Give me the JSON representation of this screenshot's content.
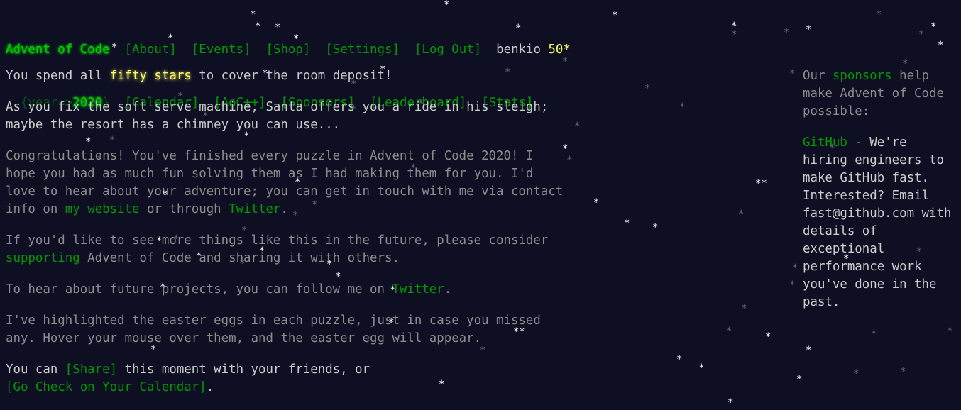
{
  "header": {
    "site_title": "Advent of Code",
    "nav_top": [
      "[About]",
      "[Events]",
      "[Shop]",
      "[Settings]",
      "[Log Out]"
    ],
    "username": "benkio",
    "star_count": "50*",
    "year_prefix": "{year=>",
    "year": "2020",
    "year_suffix": "}",
    "nav_bottom": [
      "[Calendar]",
      "[AoC++]",
      "[Sponsors]",
      "[Leaderboard]",
      "[Stats]"
    ]
  },
  "main": {
    "p1_before": "You spend all ",
    "p1_highlight": "fifty stars",
    "p1_after": " to cover the room deposit!",
    "p2_line1": "As you fix the soft serve machine, Santa offers you a ride in his sleigh;",
    "p2_line2": "maybe the resort has a chimney you can use...",
    "p3_line1": "Congratulations! You've finished every puzzle in Advent of Code 2020! I",
    "p3_line2": "hope you had as much fun solving them as I had making them for you. I'd",
    "p3_line3": "love to hear about your adventure; you can get in touch with me via contact",
    "p3_line4_a": "info on ",
    "p3_link_website": "my website",
    "p3_line4_b": " or through ",
    "p3_link_twitter": "Twitter",
    "p3_line4_c": ".",
    "p4_line1": "If you'd like to see more things like this in the future, please consider",
    "p4_link_supporting": "supporting",
    "p4_line2_rest": " Advent of Code and sharing it with others.",
    "p5_before": "To hear about future projects, you can follow me on ",
    "p5_link_twitter": "Twitter",
    "p5_after": ".",
    "p6_line1_a": "I've ",
    "p6_highlighted": "highlighted",
    "p6_line1_b": " the easter eggs in each puzzle, just in case you missed",
    "p6_line2": "any. Hover your mouse over them, and the easter egg will appear.",
    "p7_line1_a": "You can ",
    "p7_share": "[Share]",
    "p7_line1_b": " this moment with your friends, or",
    "p7_calendar": "[Go Check on Your Calendar]",
    "p7_end": "."
  },
  "sidebar": {
    "intro_a": "Our ",
    "intro_link": "sponsors",
    "intro_b": " help make Advent of Code possible:",
    "sponsor_name": "GitHub",
    "sponsor_text": " - We're hiring engineers to make GitHub fast. Interested? Email fast@github.com with details of exceptional performance work you've done in the past."
  },
  "colors": {
    "background": "#0f0f23",
    "text": "#cccccc",
    "dim_text": "#8c8c8c",
    "link_green": "#009900",
    "title_green": "#00cc00",
    "star_yellow": "#ffff66"
  }
}
